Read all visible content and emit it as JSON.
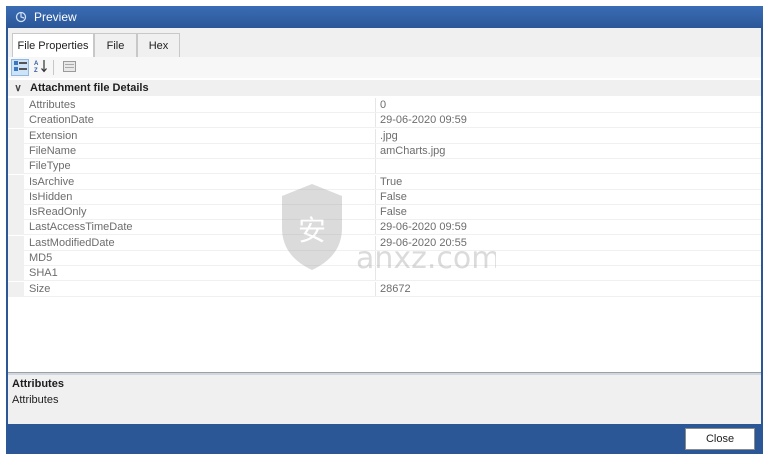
{
  "window": {
    "title": "Preview"
  },
  "tabs": [
    {
      "label": "File Properties",
      "active": true
    },
    {
      "label": "File",
      "active": false
    },
    {
      "label": "Hex",
      "active": false
    }
  ],
  "toolbar": {
    "buttons": [
      {
        "icon": "categorized-icon",
        "pressed": true
      },
      {
        "icon": "sort-alphabetical-icon",
        "pressed": false
      },
      {
        "icon": "property-pages-icon",
        "pressed": false
      }
    ]
  },
  "grid": {
    "category": "Attachment file Details",
    "properties": [
      {
        "name": "Attributes",
        "value": "0"
      },
      {
        "name": "CreationDate",
        "value": "29-06-2020 09:59"
      },
      {
        "name": "Extension",
        "value": ".jpg"
      },
      {
        "name": "FileName",
        "value": "amCharts.jpg"
      },
      {
        "name": "FileType",
        "value": ""
      },
      {
        "name": "IsArchive",
        "value": "True"
      },
      {
        "name": "IsHidden",
        "value": "False"
      },
      {
        "name": "IsReadOnly",
        "value": "False"
      },
      {
        "name": "LastAccessTimeDate",
        "value": "29-06-2020 09:59"
      },
      {
        "name": "LastModifiedDate",
        "value": "29-06-2020 20:55"
      },
      {
        "name": "MD5",
        "value": ""
      },
      {
        "name": "SHA1",
        "value": ""
      },
      {
        "name": "Size",
        "value": "28672"
      }
    ]
  },
  "description": {
    "title": "Attributes",
    "text": "Attributes"
  },
  "buttons": {
    "close_label": "Close"
  },
  "watermark": {
    "text": "anxz.com",
    "mark": "安"
  },
  "colors": {
    "titlebar": "#2b5797",
    "background": "#f0f0f0",
    "value_text": "#6d6d6d"
  }
}
